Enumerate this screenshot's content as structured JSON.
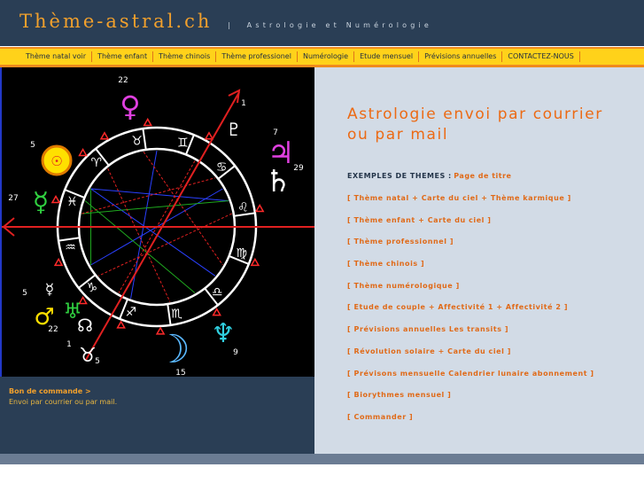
{
  "header": {
    "site_title": "Thème-astral.ch",
    "separator": "|",
    "tagline": "Astrologie et Numérologie"
  },
  "nav": {
    "items": [
      "Thème natal voir",
      "Thème enfant",
      "Thème chinois",
      "Thème professionel",
      "Numérologie",
      "Etude mensuel",
      "Prévisions annuelles",
      "CONTACTEZ-NOUS"
    ]
  },
  "chart": {
    "house_numbers": [
      "22",
      "1",
      "7",
      "29",
      "5",
      "27",
      "5",
      "22",
      "1",
      "5",
      "15",
      "9"
    ],
    "sign_glyphs": [
      "♈",
      "♉",
      "♊",
      "♋",
      "♌",
      "♍",
      "♎",
      "♏",
      "♐",
      "♑",
      "♒",
      "♓"
    ],
    "planet_glyphs": {
      "venus": "♀",
      "sun": "☉",
      "mercury": "☿",
      "jupiter": "♃",
      "saturn": "♄",
      "mars": "♂",
      "moon": "☽",
      "neptune": "♆",
      "pluto": "♇",
      "uranus": "♅"
    }
  },
  "sidebar": {
    "order_title": "Bon de commande >",
    "order_desc": "Envoi par courrier ou par mail."
  },
  "main": {
    "heading": "Astrologie envoi par courrier ou par mail",
    "examples_label": "EXEMPLES DE THEMES :",
    "examples_link": "Page de titre",
    "links": [
      "[ Thème natal + Carte du ciel + Thème karmique ]",
      "[ Thème enfant + Carte du ciel ]",
      "[ Thème professionnel ]",
      "[ Thème chinois ]",
      "[ Thème numérologique ]",
      "[ Etude de couple + Affectivité 1 + Affectivité 2 ]",
      "[ Prévisions annuelles Les transits ]",
      "[ Révolution solaire + Carte du ciel ]",
      "[ Prévisons mensuelle Calendrier lunaire abonnement ]",
      "[ Biorythmes mensuel ]",
      "[ Commander ]"
    ]
  },
  "colors": {
    "header_bg": "#2a3e55",
    "accent_orange": "#ec6a14",
    "title_orange": "#f2a02c",
    "nav_yellow": "#ffd21a",
    "content_bg": "#d2dbe6",
    "chart_bg": "#000000"
  }
}
